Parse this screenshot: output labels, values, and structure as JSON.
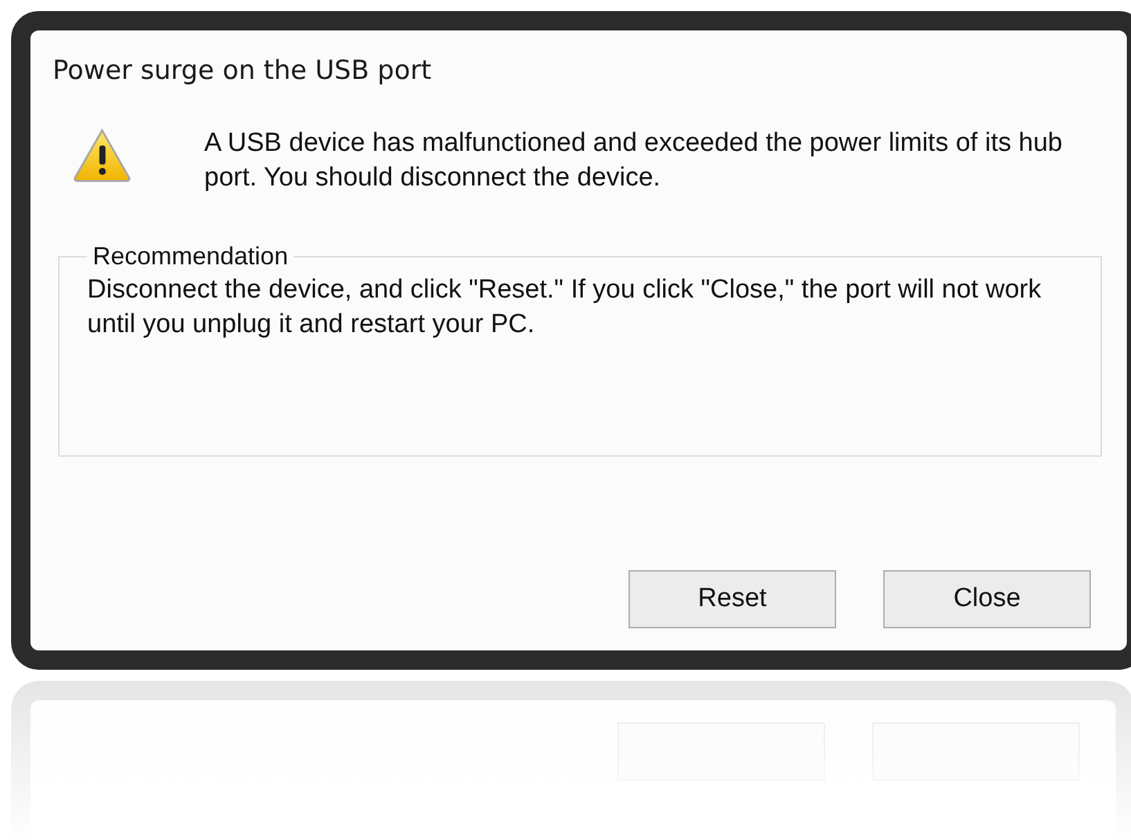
{
  "window": {
    "title": "Power surge on the USB port"
  },
  "message": "A USB device has malfunctioned and exceeded the power limits of its hub port. You should disconnect the device.",
  "group": {
    "label": "Recommendation",
    "text": "Disconnect the device, and click \"Reset.\" If you click \"Close,\" the port will not work until you unplug it and restart your PC."
  },
  "buttons": [
    {
      "label": "Reset"
    },
    {
      "label": "Close"
    }
  ]
}
